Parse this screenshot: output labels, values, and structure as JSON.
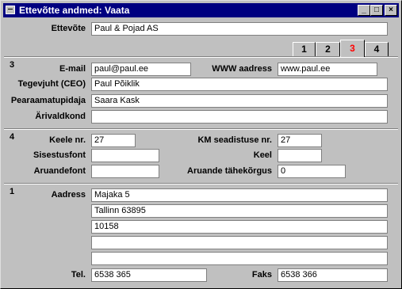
{
  "window": {
    "title": "Ettevõtte andmed: Vaata",
    "min_label": "_",
    "max_label": "□",
    "close_label": "×"
  },
  "header": {
    "ettevote_label": "Ettevõte",
    "ettevote_value": "Paul & Pojad AS"
  },
  "tabs": [
    {
      "label": "1"
    },
    {
      "label": "2"
    },
    {
      "label": "3",
      "active": true
    },
    {
      "label": "4"
    }
  ],
  "section3": {
    "number": "3",
    "email_label": "E-mail",
    "email_value": "paul@paul.ee",
    "www_label": "WWW aadress",
    "www_value": "www.paul.ee",
    "ceo_label": "Tegevjuht (CEO)",
    "ceo_value": "Paul Põiklik",
    "accountant_label": "Pearaamatupidaja",
    "accountant_value": "Saara Kask",
    "business_label": "Ärivaldkond",
    "business_value": ""
  },
  "section4": {
    "number": "4",
    "lang_no_label": "Keele nr.",
    "lang_no_value": "27",
    "vat_label": "KM seadistuse nr.",
    "vat_value": "27",
    "internal_font_label": "Sisestusfont",
    "internal_font_value": "",
    "lang_label": "Keel",
    "lang_value": "",
    "report_font_label": "Aruandefont",
    "report_font_value": "",
    "report_height_label": "Aruande tähekõrgus",
    "report_height_value": "0"
  },
  "section1": {
    "number": "1",
    "address_label": "Aadress",
    "address_lines": [
      "Majaka 5",
      "Tallinn 63895",
      "10158",
      "",
      ""
    ],
    "tel_label": "Tel.",
    "tel_value": "6538 365",
    "fax_label": "Faks",
    "fax_value": "6538 366"
  }
}
